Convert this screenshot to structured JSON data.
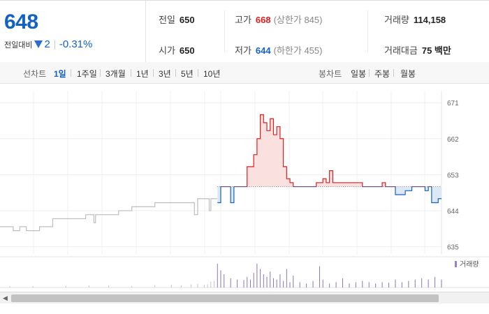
{
  "quote": {
    "price": "648",
    "change_label": "전일대비",
    "change_amount": "2",
    "change_percent": "-0.31%",
    "stats": {
      "prev_close_label": "전일",
      "prev_close": "650",
      "high_label": "고가",
      "high": "668",
      "upper_limit": "(상한가 845)",
      "volume_label": "거래량",
      "volume": "114,158",
      "open_label": "시가",
      "open": "650",
      "low_label": "저가",
      "low": "644",
      "lower_limit": "(하한가 455)",
      "value_label": "거래대금",
      "value": "75 백만"
    }
  },
  "line_chart_bar": {
    "label": "선차트",
    "periods": [
      "1일",
      "1주일",
      "3개월",
      "1년",
      "3년",
      "5년",
      "10년"
    ],
    "active_period": "1일"
  },
  "candle_chart_bar": {
    "label": "봉차트",
    "periods": [
      "일봉",
      "주봉",
      "월봉"
    ]
  },
  "volume_legend": "거래량",
  "colors": {
    "up": "#e01d1d",
    "down": "#1261c4",
    "accent": "#1261c4",
    "prev_day": "#bdbdbd"
  },
  "chart_data": {
    "type": "line",
    "title": "",
    "ylabel": "",
    "y_ticks": [
      671,
      662,
      653,
      644,
      635
    ],
    "ylim": [
      633,
      674
    ],
    "prev_close": 650,
    "prev_day_series": [
      [
        0,
        640
      ],
      [
        3,
        640
      ],
      [
        4,
        639
      ],
      [
        6,
        640
      ],
      [
        8,
        639
      ],
      [
        12,
        640
      ],
      [
        14,
        640
      ],
      [
        16,
        642
      ],
      [
        20,
        642
      ],
      [
        24,
        642
      ],
      [
        26,
        643
      ],
      [
        28,
        643
      ],
      [
        28.5,
        641
      ],
      [
        29,
        643
      ],
      [
        32,
        643
      ],
      [
        36,
        644
      ],
      [
        38,
        644
      ],
      [
        40,
        645
      ],
      [
        46,
        645
      ],
      [
        47,
        646
      ],
      [
        56,
        646
      ],
      [
        58,
        646
      ],
      [
        59,
        643
      ],
      [
        60,
        647
      ],
      [
        63,
        647
      ],
      [
        63.5,
        644
      ],
      [
        64,
        647
      ],
      [
        66,
        647
      ]
    ],
    "today_series": [
      [
        66,
        646
      ],
      [
        67,
        650
      ],
      [
        70,
        650
      ],
      [
        70,
        646
      ],
      [
        71,
        646
      ],
      [
        71,
        650
      ],
      [
        73,
        650
      ],
      [
        75,
        655
      ],
      [
        77,
        658
      ],
      [
        78,
        662
      ],
      [
        79,
        668
      ],
      [
        80,
        666
      ],
      [
        81,
        664
      ],
      [
        82,
        667
      ],
      [
        83,
        663
      ],
      [
        84,
        665
      ],
      [
        85,
        662
      ],
      [
        86,
        655
      ],
      [
        87,
        652
      ],
      [
        88,
        651
      ],
      [
        89,
        650
      ],
      [
        94,
        650
      ],
      [
        96,
        651
      ],
      [
        98,
        652
      ],
      [
        99,
        651
      ],
      [
        100,
        654
      ],
      [
        101,
        651
      ],
      [
        104,
        651
      ],
      [
        106,
        651
      ],
      [
        110,
        650
      ],
      [
        115,
        650
      ],
      [
        116,
        651
      ],
      [
        117,
        650
      ],
      [
        119,
        650
      ],
      [
        120,
        648
      ],
      [
        123,
        649
      ],
      [
        125,
        650
      ],
      [
        128,
        650
      ],
      [
        129,
        649
      ],
      [
        130,
        650
      ],
      [
        131,
        646
      ],
      [
        133,
        647
      ],
      [
        134,
        647
      ]
    ],
    "volume_bars": [
      [
        3,
        0.05
      ],
      [
        10,
        0.05
      ],
      [
        20,
        0.06
      ],
      [
        27,
        0.08
      ],
      [
        33,
        0.07
      ],
      [
        40,
        0.06
      ],
      [
        47,
        0.08
      ],
      [
        52,
        0.1
      ],
      [
        55,
        0.08
      ],
      [
        58,
        0.12
      ],
      [
        60,
        0.14
      ],
      [
        62,
        0.1
      ],
      [
        63,
        0.12
      ],
      [
        64,
        0.22
      ],
      [
        65,
        0.25
      ],
      [
        66,
        0.9
      ],
      [
        67,
        0.65
      ],
      [
        68,
        0.5
      ],
      [
        70,
        0.35
      ],
      [
        72,
        0.3
      ],
      [
        74,
        0.28
      ],
      [
        75,
        0.4
      ],
      [
        76,
        0.3
      ],
      [
        77,
        0.55
      ],
      [
        78,
        0.9
      ],
      [
        79,
        0.7
      ],
      [
        80,
        0.5
      ],
      [
        81,
        0.4
      ],
      [
        82,
        0.6
      ],
      [
        83,
        0.35
      ],
      [
        84,
        0.3
      ],
      [
        85,
        0.5
      ],
      [
        86,
        0.25
      ],
      [
        87,
        0.7
      ],
      [
        88,
        0.2
      ],
      [
        89,
        0.45
      ],
      [
        91,
        0.2
      ],
      [
        93,
        0.15
      ],
      [
        95,
        0.25
      ],
      [
        97,
        0.8
      ],
      [
        98,
        0.3
      ],
      [
        100,
        0.15
      ],
      [
        102,
        0.2
      ],
      [
        104,
        0.35
      ],
      [
        106,
        0.15
      ],
      [
        108,
        0.2
      ],
      [
        110,
        0.25
      ],
      [
        112,
        0.2
      ],
      [
        114,
        0.15
      ],
      [
        116,
        0.2
      ],
      [
        118,
        0.18
      ],
      [
        120,
        0.3
      ],
      [
        122,
        0.2
      ],
      [
        124,
        0.25
      ],
      [
        126,
        0.3
      ],
      [
        128,
        0.35
      ],
      [
        130,
        0.3
      ],
      [
        132,
        0.4
      ],
      [
        134,
        0.3
      ]
    ]
  }
}
